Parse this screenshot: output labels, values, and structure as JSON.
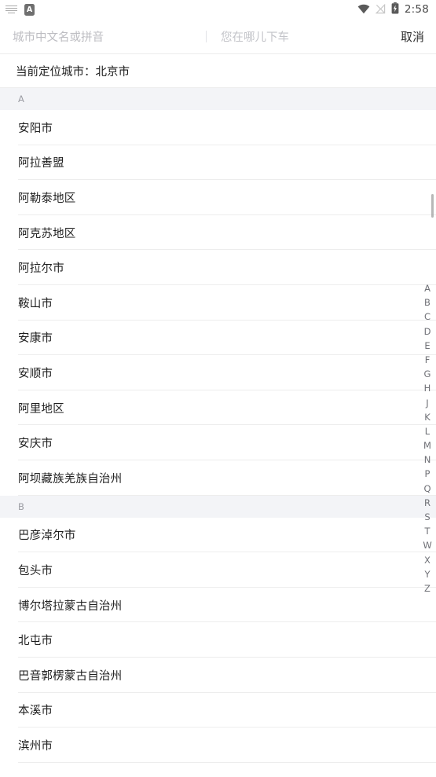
{
  "statusbar": {
    "icons_left": [
      "keyboard-icon",
      "app-badge-icon"
    ],
    "app_badge_label": "A",
    "icons_right": [
      "wifi-icon",
      "signal-off-icon",
      "battery-charging-icon"
    ],
    "time": "2:58"
  },
  "search": {
    "city_placeholder": "城市中文名或拼音",
    "city_value": "",
    "destination_placeholder": "您在哪儿下车",
    "destination_value": "",
    "cancel_label": "取消"
  },
  "located": {
    "text": "当前定位城市：北京市",
    "label": "当前定位城市：",
    "city": "北京市"
  },
  "sections": [
    {
      "letter": "A",
      "cities": [
        "安阳市",
        "阿拉善盟",
        "阿勒泰地区",
        "阿克苏地区",
        "阿拉尔市",
        "鞍山市",
        "安康市",
        "安顺市",
        "阿里地区",
        "安庆市",
        "阿坝藏族羌族自治州"
      ]
    },
    {
      "letter": "B",
      "cities": [
        "巴彦淖尔市",
        "包头市",
        "博尔塔拉蒙古自治州",
        "北屯市",
        "巴音郭楞蒙古自治州",
        "本溪市",
        "滨州市"
      ]
    }
  ],
  "alpha_index": [
    "A",
    "B",
    "C",
    "D",
    "E",
    "F",
    "G",
    "H",
    "J",
    "K",
    "L",
    "M",
    "N",
    "P",
    "Q",
    "R",
    "S",
    "T",
    "W",
    "X",
    "Y",
    "Z"
  ],
  "colors": {
    "background": "#ffffff",
    "section_header_bg": "#f3f4f7",
    "section_header_text": "#9b9ca3",
    "row_text": "#1f1f1f",
    "divider": "#ededed",
    "placeholder": "#bdbdc2",
    "index_text": "#6f7076",
    "scroll_thumb": "#9b9b9b"
  }
}
